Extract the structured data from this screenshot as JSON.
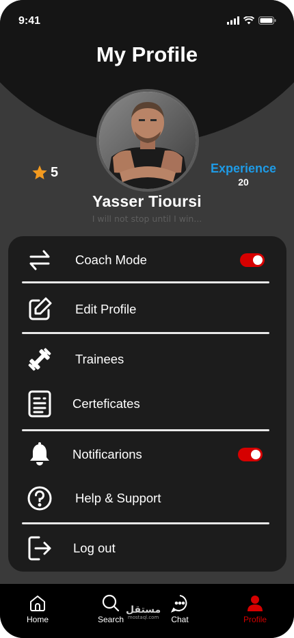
{
  "status": {
    "time": "9:41"
  },
  "header": {
    "title": "My Profile"
  },
  "profile": {
    "rating": "5",
    "experience_label": "Experience",
    "experience_value": "20",
    "name": "Yasser Tioursi",
    "bio": "I will not stop until I win..."
  },
  "menu": {
    "coach_mode": {
      "label": "Coach Mode",
      "toggle_on": true
    },
    "edit_profile": {
      "label": "Edit Profile"
    },
    "trainees": {
      "label": "Trainees"
    },
    "certificates": {
      "label": "Certeficates"
    },
    "notifications": {
      "label": "Notificarions",
      "toggle_on": true
    },
    "help": {
      "label": "Help & Support"
    },
    "logout": {
      "label": "Log out"
    }
  },
  "nav": {
    "home": "Home",
    "search": "Search",
    "chat": "Chat",
    "profile": "Profile"
  },
  "colors": {
    "accent_red": "#d60000",
    "experience_blue": "#1e9be6",
    "star_orange": "#f39a1f"
  },
  "watermark": {
    "arabic": "مستقل",
    "latin": "mostaql.com"
  }
}
